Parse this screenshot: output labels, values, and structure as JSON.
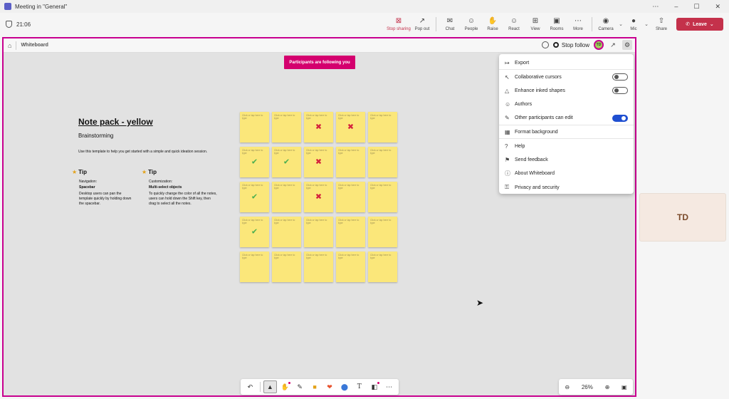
{
  "window": {
    "title": "Meeting in \"General\"",
    "controls": [
      "⋯",
      "–",
      "☐",
      "✕"
    ]
  },
  "meeting": {
    "elapsed": "21:06",
    "tools": [
      {
        "label": "Stop sharing",
        "icon": "stop-sharing-icon",
        "glyph": "⊠"
      },
      {
        "label": "Pop out",
        "icon": "pop-out-icon",
        "glyph": "↗"
      },
      {
        "label": "Chat",
        "icon": "chat-icon",
        "glyph": "✉"
      },
      {
        "label": "People",
        "icon": "people-icon",
        "glyph": "☺"
      },
      {
        "label": "Raise",
        "icon": "raise-hand-icon",
        "glyph": "✋"
      },
      {
        "label": "React",
        "icon": "react-icon",
        "glyph": "☺"
      },
      {
        "label": "View",
        "icon": "view-icon",
        "glyph": "⊞"
      },
      {
        "label": "Rooms",
        "icon": "rooms-icon",
        "glyph": "▣"
      },
      {
        "label": "More",
        "icon": "more-icon",
        "glyph": "⋯"
      }
    ],
    "camera_label": "Camera",
    "mic_label": "Mic",
    "share_label": "Share",
    "leave_label": "Leave"
  },
  "whiteboard": {
    "name": "Whiteboard",
    "stop_follow_label": "Stop follow",
    "avatar_initials": "TD",
    "banner": "Participants are following you",
    "note_title": "Note pack - yellow",
    "note_subtitle": "Brainstorming",
    "note_desc": "Use this template to help you get started with a simple and quick ideation session.",
    "tips": [
      {
        "title": "Tip",
        "label": "Navigation:",
        "bold": "Spacebar",
        "text": "Desktop users can pan the template quickly by holding down the spacebar."
      },
      {
        "title": "Tip",
        "label": "Customization:",
        "bold": "Multi-select objects",
        "text": "To quickly change the color of all the notes, users can hold down the Shift key, then drag to select all the notes."
      }
    ],
    "sticky_text": "Click or tap here to type",
    "sticky_marks": [
      "",
      "",
      "x",
      "x",
      "",
      "check",
      "check",
      "x",
      "",
      "",
      "check",
      "",
      "x",
      "",
      "",
      "check",
      "",
      "",
      "",
      "",
      "",
      "",
      "",
      "",
      ""
    ],
    "zoom": "26%"
  },
  "menu": {
    "items": [
      {
        "label": "Export",
        "icon": "export-icon",
        "glyph": "↦",
        "toggle": null
      },
      {
        "label": "Collaborative cursors",
        "icon": "cursor-icon",
        "glyph": "↖",
        "toggle": false
      },
      {
        "label": "Enhance inked shapes",
        "icon": "shapes-icon",
        "glyph": "△",
        "toggle": false
      },
      {
        "label": "Authors",
        "icon": "authors-icon",
        "glyph": "☺",
        "toggle": null
      },
      {
        "label": "Other participants can edit",
        "icon": "edit-icon",
        "glyph": "✎",
        "toggle": true
      },
      {
        "label": "Format background",
        "icon": "format-background-icon",
        "glyph": "▦",
        "toggle": null
      },
      {
        "label": "Help",
        "icon": "help-icon",
        "glyph": "?",
        "toggle": null
      },
      {
        "label": "Send feedback",
        "icon": "feedback-icon",
        "glyph": "⚑",
        "toggle": null
      },
      {
        "label": "About Whiteboard",
        "icon": "info-icon",
        "glyph": "ⓘ",
        "toggle": null
      },
      {
        "label": "Privacy and security",
        "icon": "lock-icon",
        "glyph": "⚿",
        "toggle": null
      }
    ]
  },
  "participant": {
    "initials": "TD"
  },
  "colors": {
    "frame": "#c8008f",
    "leave": "#c4314b",
    "banner": "#d4006e",
    "sticky": "#fbe77a",
    "toggle_on": "#1f4fd1"
  }
}
